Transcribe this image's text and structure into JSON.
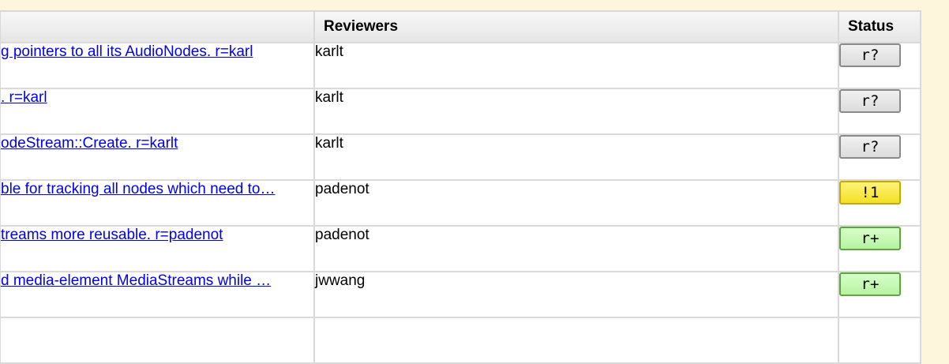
{
  "header": {
    "reviewers_label": "Reviewers",
    "status_label": "Status"
  },
  "rows": [
    {
      "description": "g pointers to all its AudioNodes. r=karl",
      "reviewer": "karlt",
      "status": "r?",
      "status_color": "#e6e6e6"
    },
    {
      "description": ". r=karl",
      "reviewer": "karlt",
      "status": "r?",
      "status_color": "#e6e6e6"
    },
    {
      "description": "odeStream::Create. r=karlt",
      "reviewer": "karlt",
      "status": "r?",
      "status_color": "#e6e6e6"
    },
    {
      "description": "ble for tracking all nodes which need to…",
      "reviewer": "padenot",
      "status": "!1",
      "status_color": "#f7e84a"
    },
    {
      "description": "treams more reusable. r=padenot",
      "reviewer": "padenot",
      "status": "r+",
      "status_color": "#c8f7b4"
    },
    {
      "description": "d media-element MediaStreams while …",
      "reviewer": "jwwang",
      "status": "r+",
      "status_color": "#c8f7b4"
    }
  ]
}
